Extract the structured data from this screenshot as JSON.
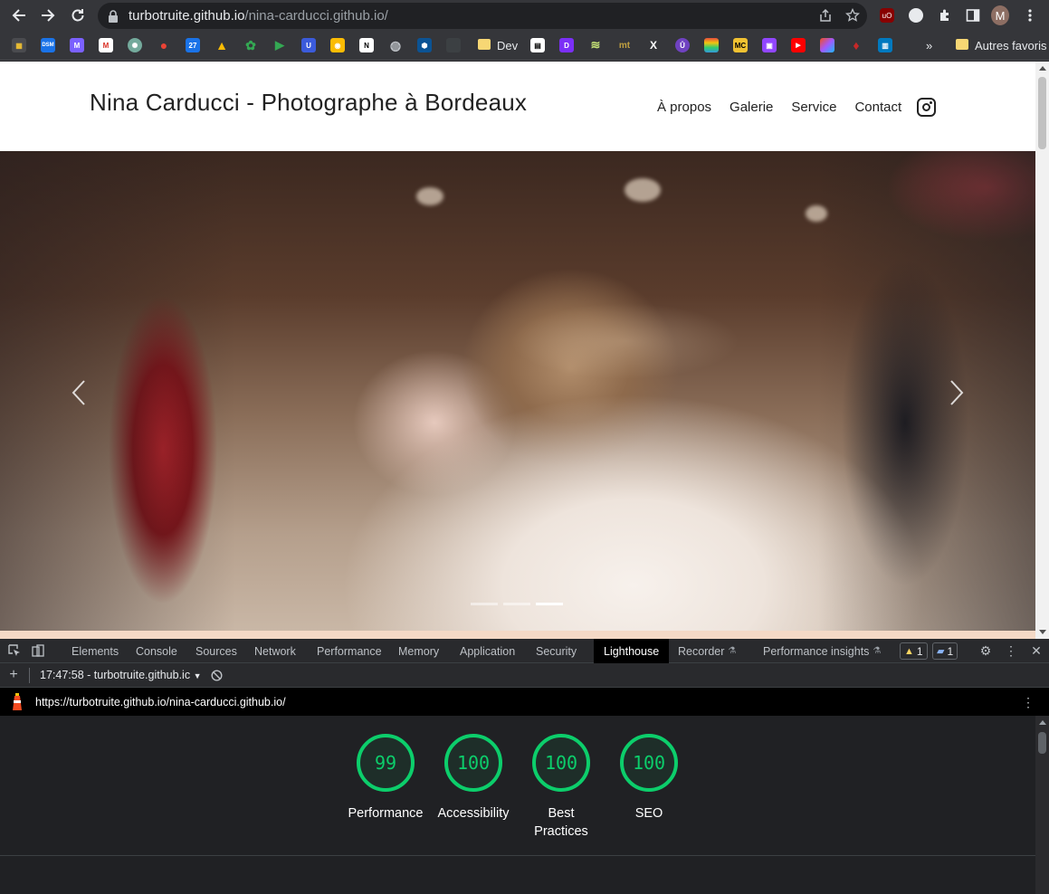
{
  "browser": {
    "url_host": "turbotruite.github.io",
    "url_path": "/nina-carducci.github.io/",
    "profile_initial": "M",
    "bookmarks": {
      "dev_label": "Dev",
      "other_label": "Autres favoris",
      "icons": [
        "dsm",
        "mail",
        "gmail",
        "openai",
        "maps",
        "calendar",
        "drive",
        "photos",
        "play",
        "u",
        "keep",
        "notion",
        "globe",
        "hex",
        "blank",
        "folder-dev",
        "doc",
        "d",
        "stack",
        "mt",
        "x",
        "u2",
        "stripe",
        "mc",
        "twitch",
        "youtube",
        "figma",
        "drop",
        "trello"
      ],
      "icon_text": {
        "dsm": "DSM",
        "cal": "27",
        "u": "U",
        "mt": "mt",
        "x": "X",
        "mc": "MC",
        "notion": "N"
      },
      "overflow": "»"
    }
  },
  "site": {
    "title": "Nina Carducci - Photographe à Bordeaux",
    "nav": [
      "À propos",
      "Galerie",
      "Service",
      "Contact"
    ],
    "carousel": {
      "slides": 3,
      "active": 3
    }
  },
  "devtools": {
    "tabs": [
      "Elements",
      "Console",
      "Sources",
      "Network",
      "Performance",
      "Memory",
      "Application",
      "Security",
      "Lighthouse",
      "Recorder",
      "Performance insights"
    ],
    "active_tab": "Lighthouse",
    "warnings": "1",
    "messages": "1",
    "run_label": "17:47:58 - turbotruite.github.ic",
    "report_url": "https://turbotruite.github.io/nina-carducci.github.io/",
    "scores": [
      {
        "value": "99",
        "label": "Performance"
      },
      {
        "value": "100",
        "label": "Accessibility"
      },
      {
        "value": "100",
        "label": "Best Practices"
      },
      {
        "value": "100",
        "label": "SEO"
      }
    ],
    "score_color": "#0cce6b"
  }
}
